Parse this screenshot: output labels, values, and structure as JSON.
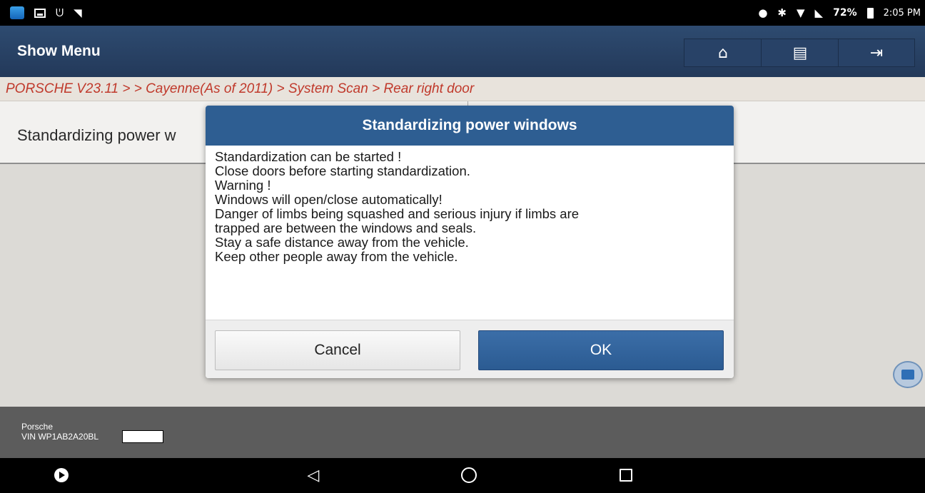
{
  "status_bar": {
    "battery": "72%",
    "time": "2:05 PM",
    "icons": [
      "app-icon",
      "image-icon",
      "stethoscope-icon",
      "wifi-unknown-icon",
      "location-icon",
      "bluetooth-off-icon",
      "wifi-icon",
      "no-sim-icon",
      "battery-icon"
    ]
  },
  "header": {
    "title": "Show Menu",
    "toolbar": [
      "home-icon",
      "print-icon",
      "exit-icon"
    ]
  },
  "breadcrumb": "PORSCHE V23.11 > > Cayenne(As of 2011) > System Scan > Rear right door",
  "function": {
    "label": "Standardizing power w"
  },
  "dialog": {
    "title": "Standardizing power windows",
    "lines": [
      "Standardization can be started !",
      "Close doors before starting standardization.",
      "Warning !",
      "Windows will open/close automatically!",
      "Danger of limbs being squashed and serious injury if limbs are",
      "trapped are between the windows and seals.",
      "Stay a safe distance away from the vehicle.",
      "Keep other people away from the vehicle."
    ],
    "cancel_label": "Cancel",
    "ok_label": "OK"
  },
  "footer": {
    "make": "Porsche",
    "vin": "VIN WP1AB2A20BL"
  },
  "navigation": [
    "play-icon",
    "back-icon",
    "home-circle-icon",
    "recents-icon"
  ],
  "colors": {
    "header": "#2e4b70",
    "dialog_title": "#2e5e92",
    "ok_button": "#2e5e92",
    "breadcrumb_text": "#c0392b"
  }
}
